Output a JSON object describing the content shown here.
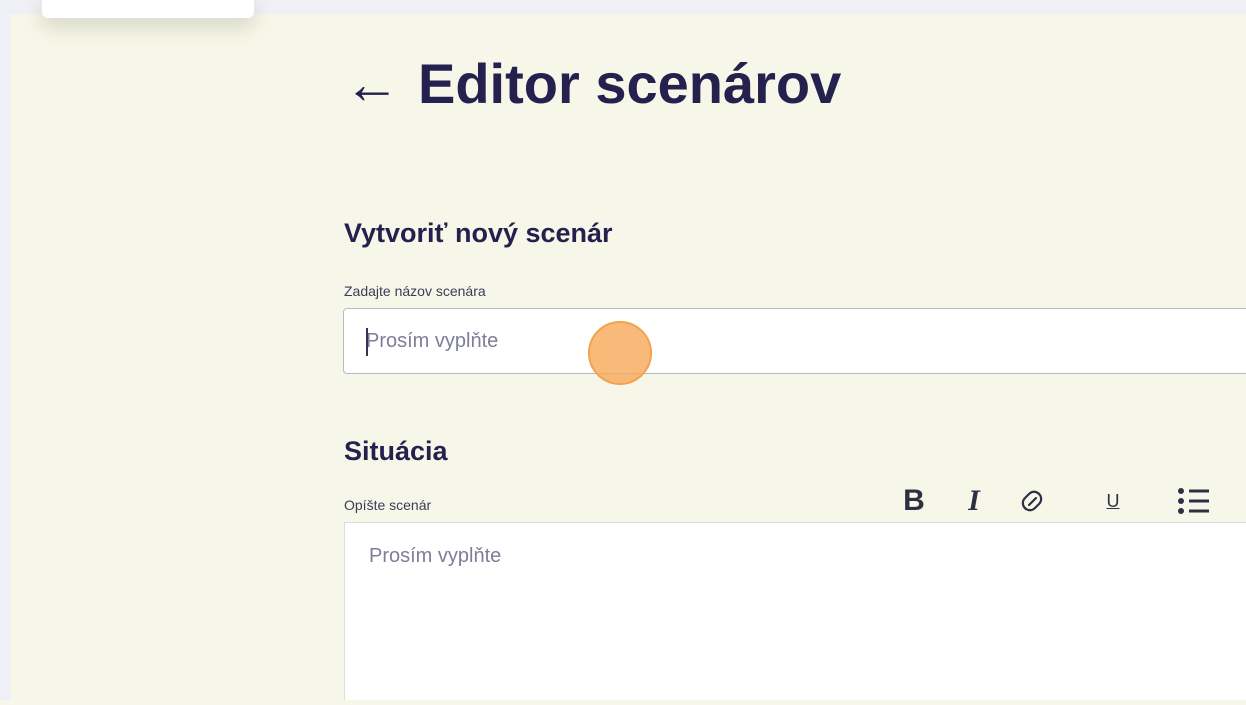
{
  "page": {
    "back_arrow": "←",
    "title": "Editor scenárov"
  },
  "create_section": {
    "heading": "Vytvoriť nový scenár",
    "name_label": "Zadajte názov scenára",
    "name_placeholder": "Prosím vyplňte",
    "name_value": ""
  },
  "situation_section": {
    "heading": "Situácia",
    "description_label": "Opíšte scenár",
    "description_placeholder": "Prosím vyplňte",
    "toolbar": {
      "bold_label": "B",
      "italic_label": "I",
      "link_icon": "link-icon",
      "underline_label": "U",
      "list_icon": "bulleted-list-icon"
    }
  }
}
